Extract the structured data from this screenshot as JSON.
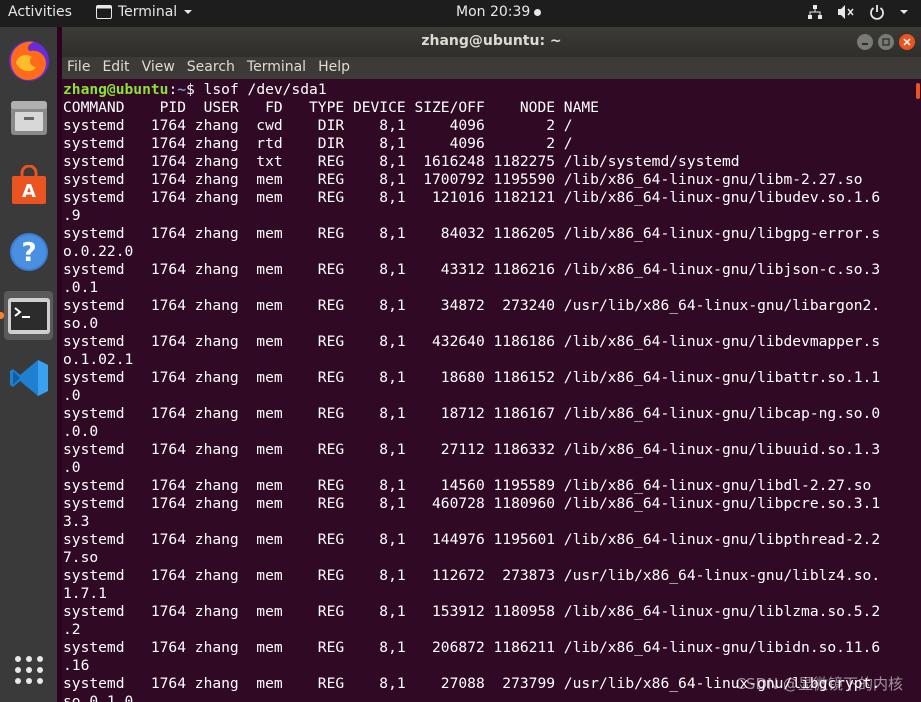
{
  "topbar": {
    "activities": "Activities",
    "app_name": "Terminal",
    "clock": "Mon 20:39"
  },
  "dock": {
    "items": [
      "firefox-icon",
      "files-icon",
      "software-icon",
      "help-icon",
      "terminal-icon",
      "vscode-icon",
      "app-grid-icon"
    ]
  },
  "window": {
    "title": "zhang@ubuntu: ~",
    "menu": [
      "File",
      "Edit",
      "View",
      "Search",
      "Terminal",
      "Help"
    ]
  },
  "terminal": {
    "prompt_user": "zhang@ubuntu",
    "prompt_sep": ":",
    "prompt_path": "~",
    "prompt_end": "$ ",
    "command": "lsof /dev/sda1",
    "lines": [
      "COMMAND    PID  USER   FD   TYPE DEVICE SIZE/OFF    NODE NAME",
      "systemd   1764 zhang  cwd    DIR    8,1     4096       2 /",
      "systemd   1764 zhang  rtd    DIR    8,1     4096       2 /",
      "systemd   1764 zhang  txt    REG    8,1  1616248 1182275 /lib/systemd/systemd",
      "systemd   1764 zhang  mem    REG    8,1  1700792 1195590 /lib/x86_64-linux-gnu/libm-2.27.so",
      "systemd   1764 zhang  mem    REG    8,1   121016 1182121 /lib/x86_64-linux-gnu/libudev.so.1.6",
      ".9",
      "systemd   1764 zhang  mem    REG    8,1    84032 1186205 /lib/x86_64-linux-gnu/libgpg-error.s",
      "o.0.22.0",
      "systemd   1764 zhang  mem    REG    8,1    43312 1186216 /lib/x86_64-linux-gnu/libjson-c.so.3",
      ".0.1",
      "systemd   1764 zhang  mem    REG    8,1    34872  273240 /usr/lib/x86_64-linux-gnu/libargon2.",
      "so.0",
      "systemd   1764 zhang  mem    REG    8,1   432640 1186186 /lib/x86_64-linux-gnu/libdevmapper.s",
      "o.1.02.1",
      "systemd   1764 zhang  mem    REG    8,1    18680 1186152 /lib/x86_64-linux-gnu/libattr.so.1.1",
      ".0",
      "systemd   1764 zhang  mem    REG    8,1    18712 1186167 /lib/x86_64-linux-gnu/libcap-ng.so.0",
      ".0.0",
      "systemd   1764 zhang  mem    REG    8,1    27112 1186332 /lib/x86_64-linux-gnu/libuuid.so.1.3",
      ".0",
      "systemd   1764 zhang  mem    REG    8,1    14560 1195589 /lib/x86_64-linux-gnu/libdl-2.27.so",
      "systemd   1764 zhang  mem    REG    8,1   460728 1180960 /lib/x86_64-linux-gnu/libpcre.so.3.1",
      "3.3",
      "systemd   1764 zhang  mem    REG    8,1   144976 1195601 /lib/x86_64-linux-gnu/libpthread-2.2",
      "7.so",
      "systemd   1764 zhang  mem    REG    8,1   112672  273873 /usr/lib/x86_64-linux-gnu/liblz4.so.",
      "1.7.1",
      "systemd   1764 zhang  mem    REG    8,1   153912 1180958 /lib/x86_64-linux-gnu/liblzma.so.5.2",
      ".2",
      "systemd   1764 zhang  mem    REG    8,1   206872 1186211 /lib/x86_64-linux-gnu/libidn.so.11.6",
      ".16",
      "systemd   1764 zhang  mem    REG    8,1    27088  273799 /usr/lib/x86_64-linux-gnu/libgcrypt.",
      "so.0.1.0"
    ]
  },
  "watermark": "CSDN @显微镜下的内核",
  "colors": {
    "terminal_bg": "#300a24",
    "prompt_user": "#8ae234",
    "prompt_path": "#729fcf",
    "accent": "#e95420"
  }
}
